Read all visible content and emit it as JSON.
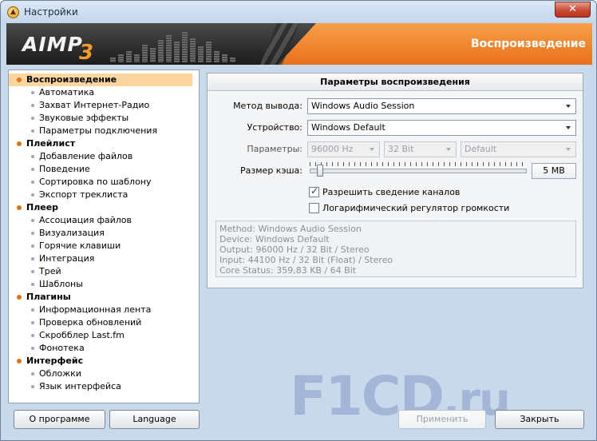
{
  "window": {
    "title": "Настройки",
    "close_glyph": "✕"
  },
  "banner": {
    "logo": "AIMP",
    "logo_version": "3",
    "section_title": "Воспроизведение"
  },
  "tree": [
    {
      "label": "Воспроизведение",
      "level": 0,
      "selected": true
    },
    {
      "label": "Автоматика",
      "level": 1
    },
    {
      "label": "Захват Интернет-Радио",
      "level": 1
    },
    {
      "label": "Звуковые эффекты",
      "level": 1
    },
    {
      "label": "Параметры подключения",
      "level": 1
    },
    {
      "label": "Плейлист",
      "level": 0
    },
    {
      "label": "Добавление файлов",
      "level": 1
    },
    {
      "label": "Поведение",
      "level": 1
    },
    {
      "label": "Сортировка по шаблону",
      "level": 1
    },
    {
      "label": "Экспорт треклиста",
      "level": 1
    },
    {
      "label": "Плеер",
      "level": 0
    },
    {
      "label": "Ассоциация файлов",
      "level": 1
    },
    {
      "label": "Визуализация",
      "level": 1
    },
    {
      "label": "Горячие клавиши",
      "level": 1
    },
    {
      "label": "Интеграция",
      "level": 1
    },
    {
      "label": "Трей",
      "level": 1
    },
    {
      "label": "Шаблоны",
      "level": 1
    },
    {
      "label": "Плагины",
      "level": 0
    },
    {
      "label": "Информационная лента",
      "level": 1
    },
    {
      "label": "Проверка обновлений",
      "level": 1
    },
    {
      "label": "Скробблер Last.fm",
      "level": 1
    },
    {
      "label": "Фонотека",
      "level": 1
    },
    {
      "label": "Интерфейс",
      "level": 0
    },
    {
      "label": "Обложки",
      "level": 1
    },
    {
      "label": "Язык интерфейса",
      "level": 1
    }
  ],
  "panel": {
    "header": "Параметры воспроизведения",
    "output_label": "Метод вывода:",
    "output_value": "Windows Audio Session",
    "device_label": "Устройство:",
    "device_value": "Windows Default",
    "params_label": "Параметры:",
    "rate_value": "96000 Hz",
    "bits_value": "32 Bit",
    "channels_value": "Default",
    "cache_label": "Размер кэша:",
    "cache_value": "5 MB",
    "mix_label": "Разрешить сведение каналов",
    "mix_checked": true,
    "log_label": "Логарифмический регулятор громкости",
    "log_checked": false,
    "info": [
      "Method: Windows Audio Session",
      "Device: Windows Default",
      "Output: 96000 Hz / 32 Bit / Stereo",
      "Input: 44100 Hz / 32 Bit (Float) / Stereo",
      "Core Status: 359,83 KB / 64 Bit"
    ]
  },
  "buttons": {
    "about": "О программе",
    "language": "Language",
    "apply": "Применить",
    "close": "Закрыть"
  },
  "watermark": {
    "main": "F1CD",
    "suffix": ".ru"
  }
}
